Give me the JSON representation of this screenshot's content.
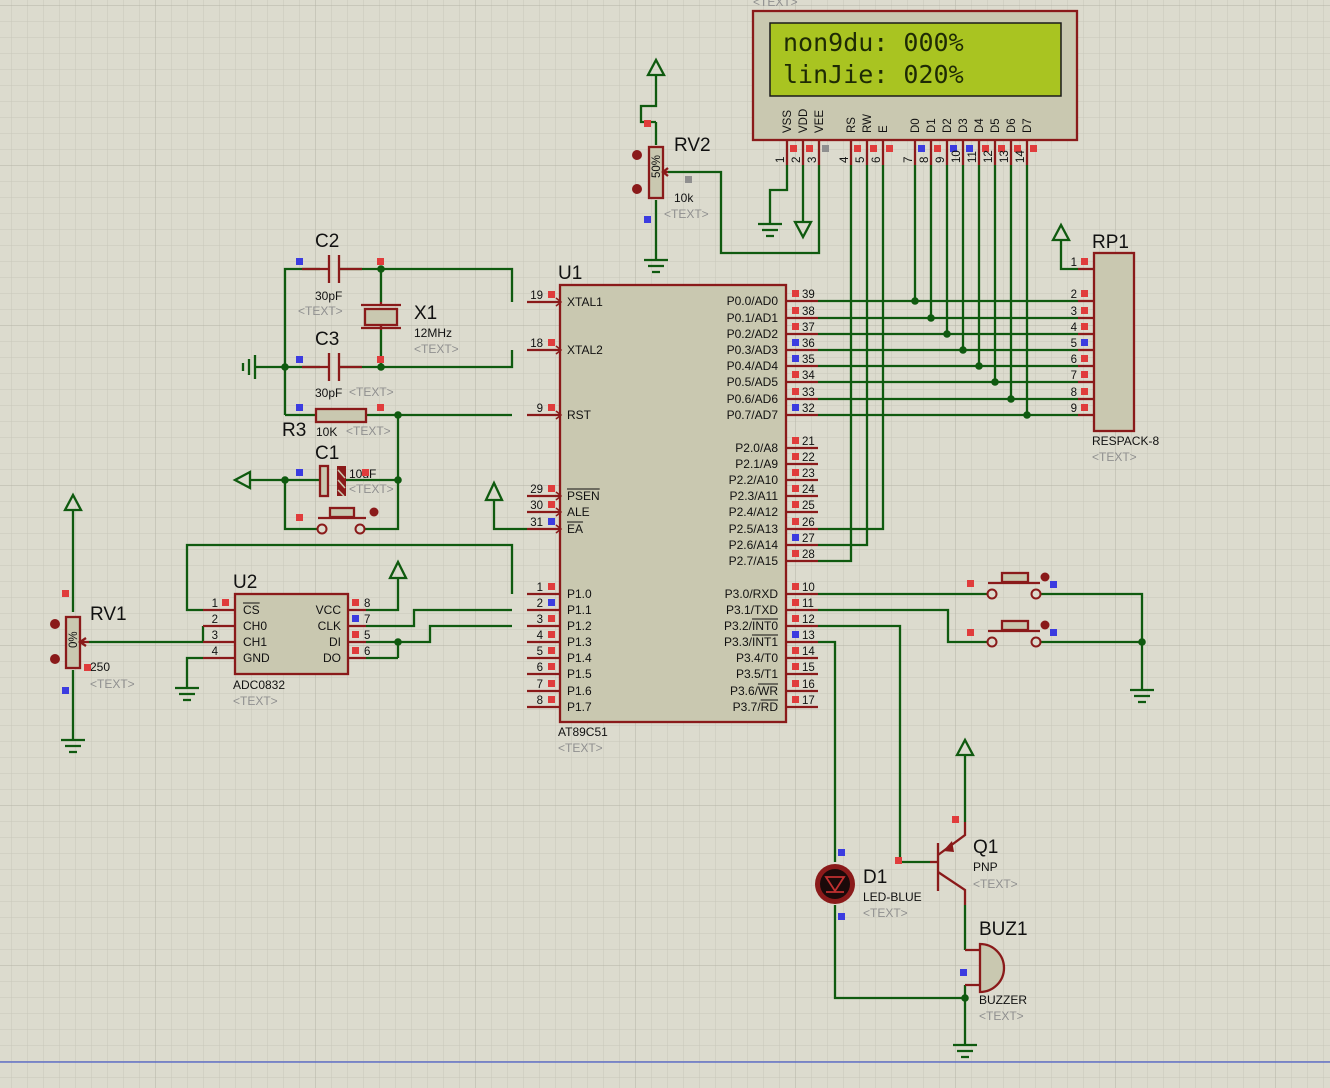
{
  "colors": {
    "background": "#dcdbce",
    "grid_minor": "#c8c7ba",
    "grid_major": "#b8b7aa",
    "wire": "#0f5a0f",
    "component": "#8a1a1a",
    "component_fill": "#c9c8b0",
    "lcd_screen": "#a9c421",
    "pin_red": "#e03c3c",
    "pin_blue": "#3c3ce0"
  },
  "text_placeholder": "<TEXT>",
  "lcd": {
    "line1": "non9du: 000%",
    "line2": "linJie: 020%",
    "pin_names": [
      "VSS",
      "VDD",
      "VEE",
      "RS",
      "RW",
      "E",
      "D0",
      "D1",
      "D2",
      "D3",
      "D4",
      "D5",
      "D6",
      "D7"
    ],
    "pin_numbers": [
      "1",
      "2",
      "3",
      "4",
      "5",
      "6",
      "7",
      "8",
      "9",
      "10",
      "11",
      "12",
      "13",
      "14"
    ]
  },
  "u1": {
    "ref": "U1",
    "value": "AT89C51",
    "left_pins": [
      {
        "num": "19",
        "name": "XTAL1"
      },
      {
        "num": "18",
        "name": "XTAL2"
      },
      {
        "num": "9",
        "name": "RST"
      },
      {
        "num": "29",
        "name": "PSEN"
      },
      {
        "num": "30",
        "name": "ALE"
      },
      {
        "num": "31",
        "name": "EA"
      },
      {
        "num": "1",
        "name": "P1.0"
      },
      {
        "num": "2",
        "name": "P1.1"
      },
      {
        "num": "3",
        "name": "P1.2"
      },
      {
        "num": "4",
        "name": "P1.3"
      },
      {
        "num": "5",
        "name": "P1.4"
      },
      {
        "num": "6",
        "name": "P1.5"
      },
      {
        "num": "7",
        "name": "P1.6"
      },
      {
        "num": "8",
        "name": "P1.7"
      }
    ],
    "right_pins": [
      {
        "num": "39",
        "name": "P0.0/AD0"
      },
      {
        "num": "38",
        "name": "P0.1/AD1"
      },
      {
        "num": "37",
        "name": "P0.2/AD2"
      },
      {
        "num": "36",
        "name": "P0.3/AD3"
      },
      {
        "num": "35",
        "name": "P0.4/AD4"
      },
      {
        "num": "34",
        "name": "P0.5/AD5"
      },
      {
        "num": "33",
        "name": "P0.6/AD6"
      },
      {
        "num": "32",
        "name": "P0.7/AD7"
      },
      {
        "num": "21",
        "name": "P2.0/A8"
      },
      {
        "num": "22",
        "name": "P2.1/A9"
      },
      {
        "num": "23",
        "name": "P2.2/A10"
      },
      {
        "num": "24",
        "name": "P2.3/A11"
      },
      {
        "num": "25",
        "name": "P2.4/A12"
      },
      {
        "num": "26",
        "name": "P2.5/A13"
      },
      {
        "num": "27",
        "name": "P2.6/A14"
      },
      {
        "num": "28",
        "name": "P2.7/A15"
      },
      {
        "num": "10",
        "name": "P3.0/RXD"
      },
      {
        "num": "11",
        "name": "P3.1/TXD"
      },
      {
        "num": "12",
        "name": "P3.2/INT0"
      },
      {
        "num": "13",
        "name": "P3.3/INT1"
      },
      {
        "num": "14",
        "name": "P3.4/T0"
      },
      {
        "num": "15",
        "name": "P3.5/T1"
      },
      {
        "num": "16",
        "name": "P3.6/WR"
      },
      {
        "num": "17",
        "name": "P3.7/RD"
      }
    ]
  },
  "u2": {
    "ref": "U2",
    "value": "ADC0832",
    "left_pins": [
      {
        "num": "1",
        "name": "CS"
      },
      {
        "num": "2",
        "name": "CH0"
      },
      {
        "num": "3",
        "name": "CH1"
      },
      {
        "num": "4",
        "name": "GND"
      }
    ],
    "right_pins": [
      {
        "num": "8",
        "name": "VCC"
      },
      {
        "num": "7",
        "name": "CLK"
      },
      {
        "num": "5",
        "name": "DI"
      },
      {
        "num": "6",
        "name": "DO"
      }
    ]
  },
  "rp1": {
    "ref": "RP1",
    "value": "RESPACK-8",
    "pins": [
      "1",
      "2",
      "3",
      "4",
      "5",
      "6",
      "7",
      "8",
      "9"
    ]
  },
  "rv1": {
    "ref": "RV1",
    "value": "250",
    "percent": "0%"
  },
  "rv2": {
    "ref": "RV2",
    "value": "10k",
    "percent": "50%"
  },
  "c1": {
    "ref": "C1",
    "value": "10uF"
  },
  "c2": {
    "ref": "C2",
    "value": "30pF"
  },
  "c3": {
    "ref": "C3",
    "value": "30pF"
  },
  "x1": {
    "ref": "X1",
    "value": "12MHz"
  },
  "r3": {
    "ref": "R3",
    "value": "10K"
  },
  "d1": {
    "ref": "D1",
    "value": "LED-BLUE"
  },
  "q1": {
    "ref": "Q1",
    "value": "PNP"
  },
  "buz1": {
    "ref": "BUZ1",
    "value": "BUZZER"
  }
}
